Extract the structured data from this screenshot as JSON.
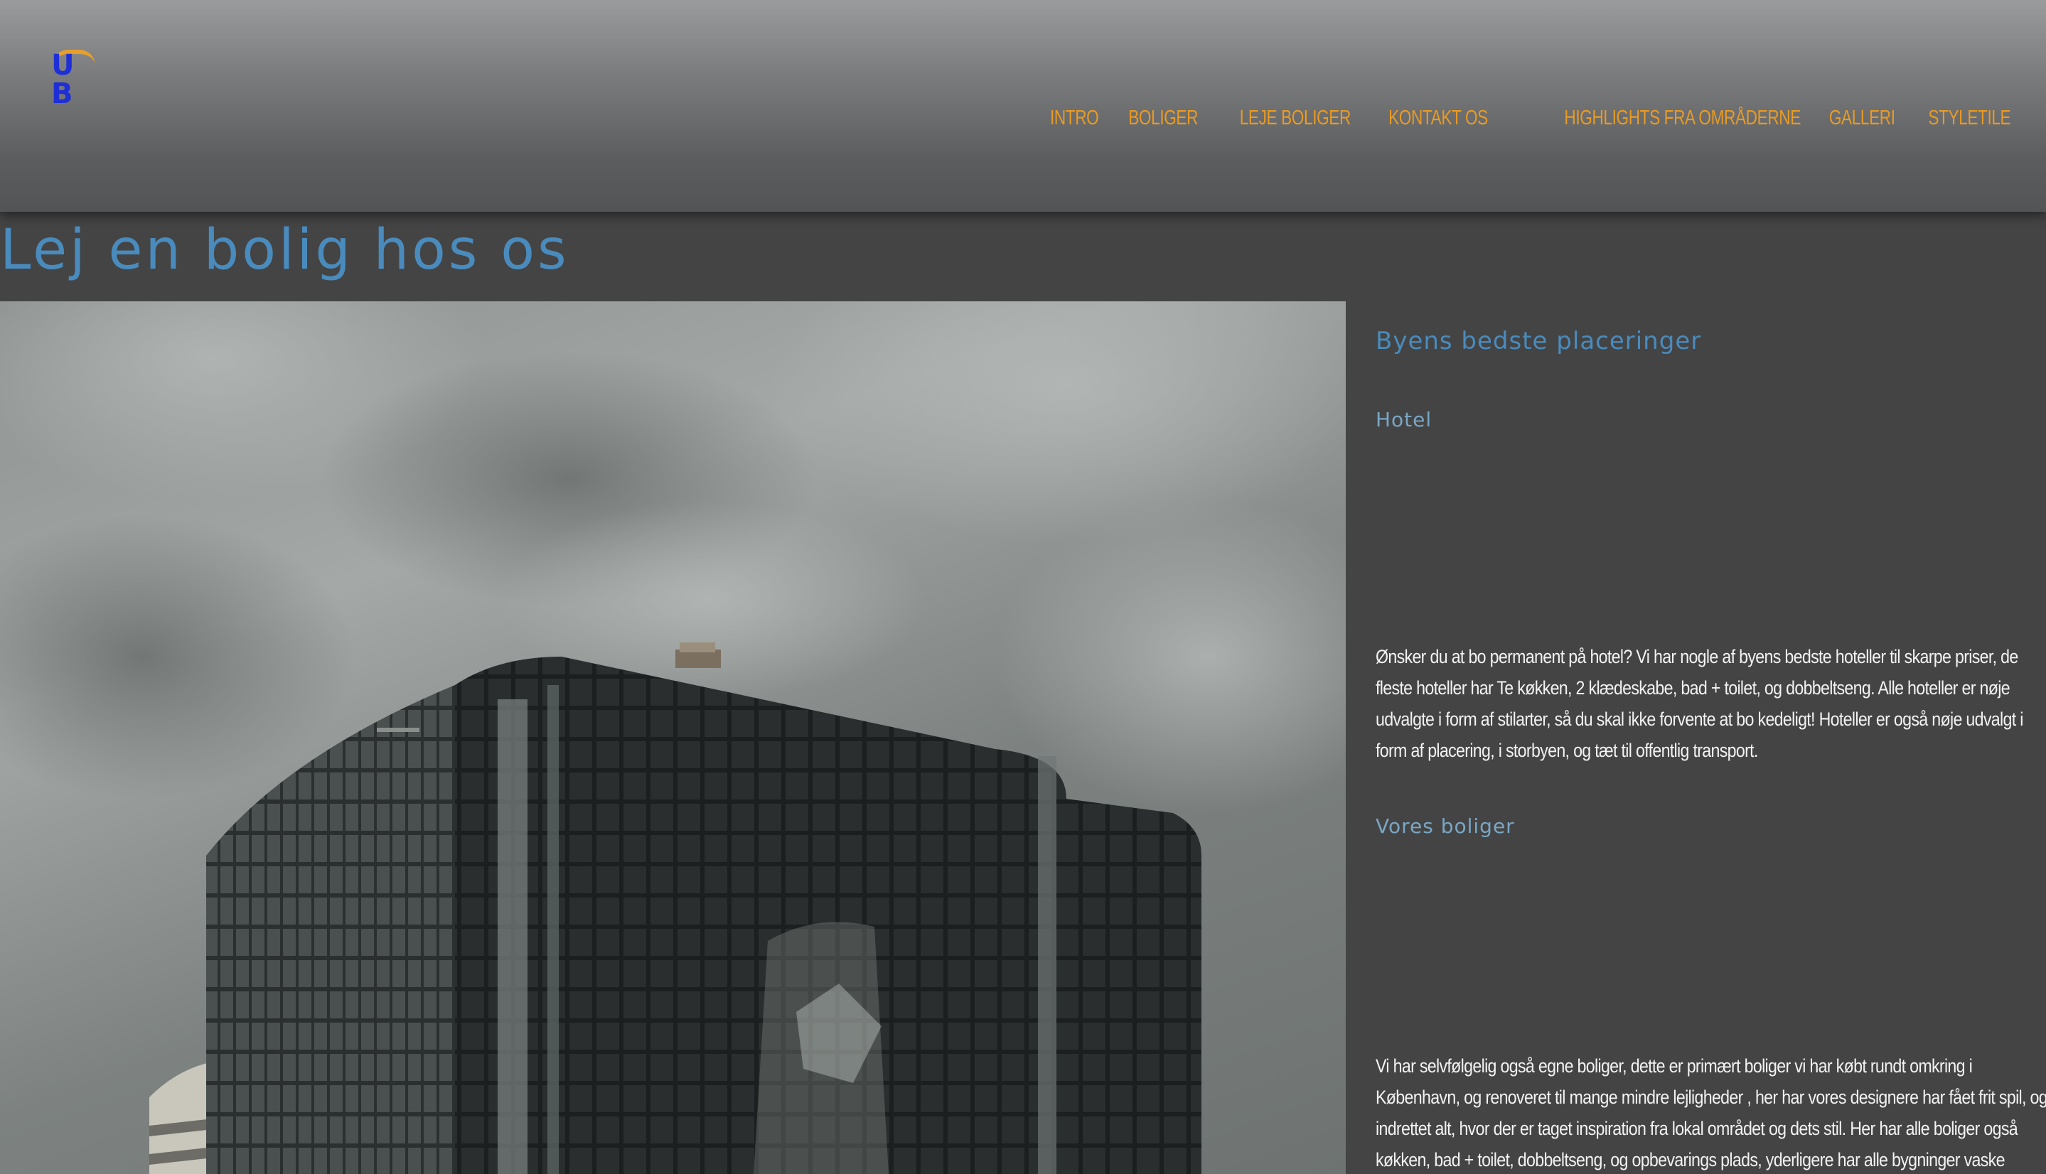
{
  "logo": {
    "letters": "U B"
  },
  "nav": {
    "items": [
      {
        "label": "INTRO"
      },
      {
        "label": "BOLIGER"
      },
      {
        "label": "LEJE BOLIGER"
      },
      {
        "label": "KONTAKT OS"
      },
      {
        "label": "HIGHLIGHTS FRA OMRÅDERNE"
      },
      {
        "label": "GALLERI"
      },
      {
        "label": "STYLETILE"
      }
    ]
  },
  "page": {
    "title": "Lej en bolig hos os"
  },
  "sidebar": {
    "heading": "Byens bedste placeringer",
    "hotel_heading": "Hotel",
    "hotel_text": "Ønsker du at bo permanent på hotel? Vi har nogle af byens bedste hoteller til skarpe priser, de fleste hoteller har Te køkken, 2 klædeskabe, bad + toilet, og dobbeltseng. Alle hoteller er nøje udvalgte i form af stilarter, så du skal ikke forvente at bo kedeligt! Hoteller er også nøje udvalgt i form af placering, i storbyen, og tæt til offentlig transport.",
    "boliger_heading": "Vores boliger",
    "boliger_text": "Vi har selvfølgelig også egne boliger, dette er primært boliger vi har købt rundt omkring i København, og renoveret til mange mindre lejligheder , her har vores designere har fået frit spil, og indrettet alt, hvor der er taget inspiration fra lokal området og dets stil. Her har alle boliger også køkken, bad + toilet, dobbeltseng, og opbevarings plads, yderligere har alle bygninger vaske"
  },
  "colors": {
    "accent_orange": "#e89b24",
    "heading_blue": "#4a8bbd",
    "background": "#444444"
  }
}
